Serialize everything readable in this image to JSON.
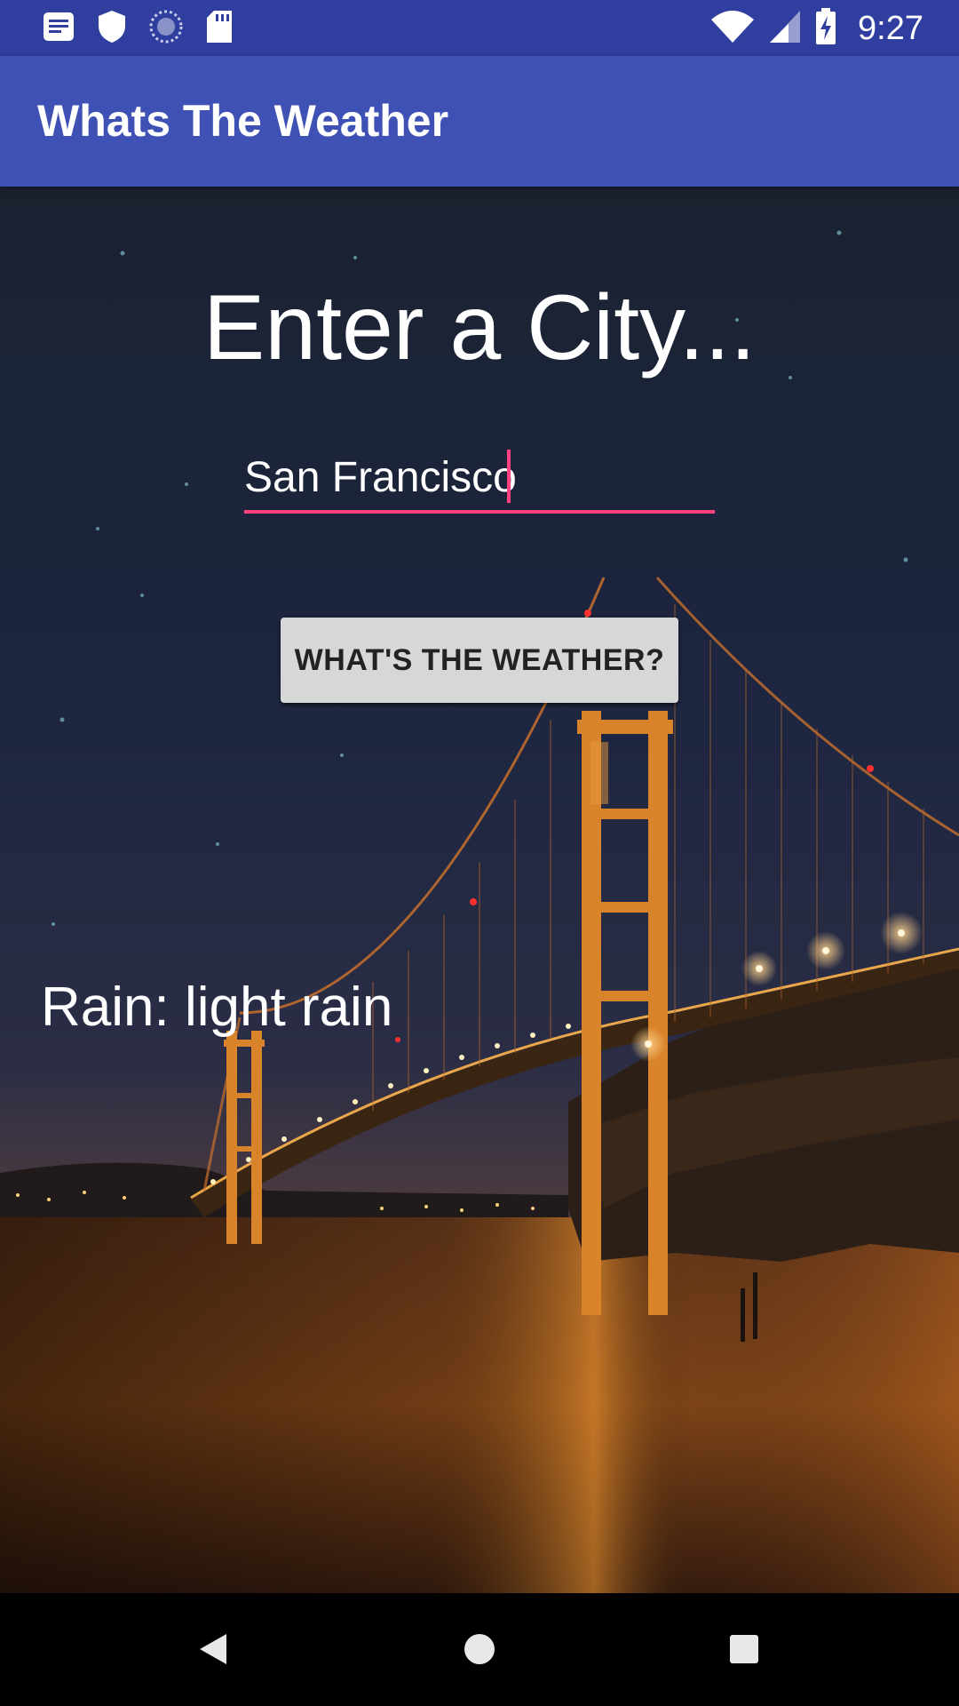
{
  "status_bar": {
    "time": "9:27",
    "left_icons": [
      "notes-icon",
      "shield-icon",
      "sync-icon",
      "sd-card-icon"
    ],
    "right_icons": [
      "wifi-icon",
      "signal-icon",
      "battery-charging-icon"
    ]
  },
  "app_bar": {
    "title": "Whats The Weather",
    "color": "#3f51b5",
    "status_color": "#303f9f"
  },
  "main": {
    "heading": "Enter a City...",
    "city_input": {
      "value": "San Francisco",
      "placeholder": ""
    },
    "weather_button_label": "WHAT'S THE WEATHER?",
    "result": "Rain: light rain",
    "accent_color": "#ff4081"
  },
  "nav_bar": {
    "buttons": [
      "back-icon",
      "home-icon",
      "recents-icon"
    ]
  }
}
